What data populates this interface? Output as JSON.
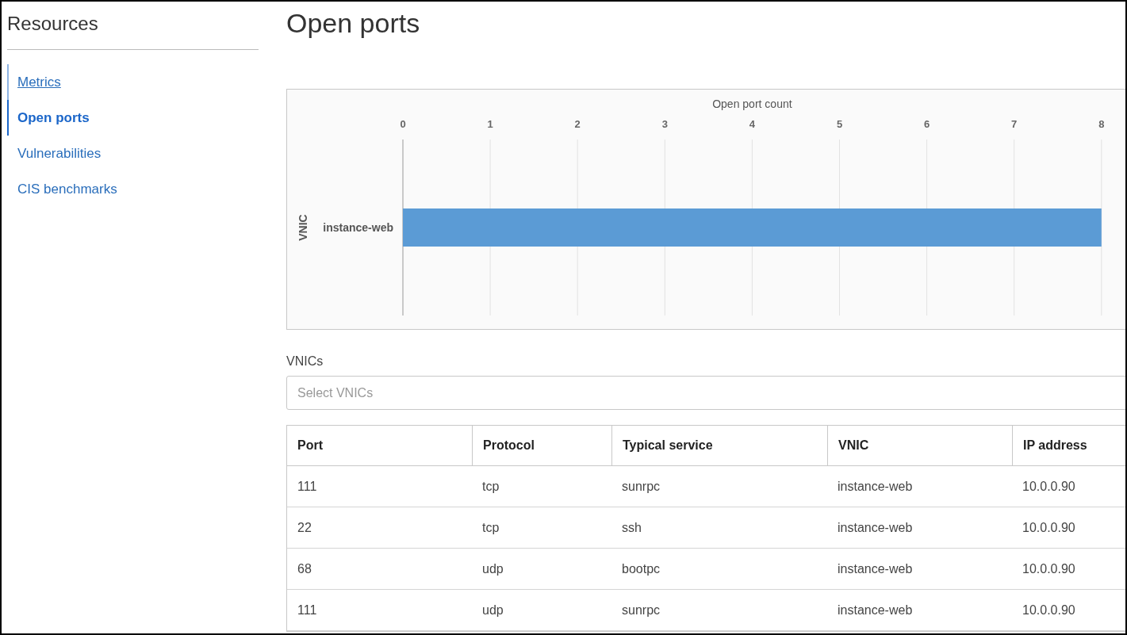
{
  "sidebar": {
    "title": "Resources",
    "items": [
      {
        "label": "Metrics",
        "selected": false,
        "hovered": true
      },
      {
        "label": "Open ports",
        "selected": true,
        "hovered": false
      },
      {
        "label": "Vulnerabilities",
        "selected": false,
        "hovered": false
      },
      {
        "label": "CIS benchmarks",
        "selected": false,
        "hovered": false
      }
    ]
  },
  "main": {
    "title": "Open ports",
    "chart": {
      "chart_data": {
        "type": "bar",
        "orientation": "horizontal",
        "xlabel": "Open port count",
        "ylabel": "VNIC",
        "categories": [
          "instance-web"
        ],
        "series": [
          {
            "color": "#5b9bd5",
            "values": [
              8
            ]
          }
        ],
        "grid": true,
        "xlim": [
          0,
          8
        ],
        "xticks": [
          0,
          1,
          2,
          3,
          4,
          5,
          6,
          7,
          8
        ]
      }
    },
    "vnic_filter": {
      "label": "VNICs",
      "placeholder": "Select VNICs"
    },
    "table": {
      "columns": [
        "Port",
        "Protocol",
        "Typical service",
        "VNIC",
        "IP address"
      ],
      "rows": [
        [
          "111",
          "tcp",
          "sunrpc",
          "instance-web",
          "10.0.0.90"
        ],
        [
          "22",
          "tcp",
          "ssh",
          "instance-web",
          "10.0.0.90"
        ],
        [
          "68",
          "udp",
          "bootpc",
          "instance-web",
          "10.0.0.90"
        ],
        [
          "111",
          "udp",
          "sunrpc",
          "instance-web",
          "10.0.0.90"
        ]
      ]
    }
  }
}
